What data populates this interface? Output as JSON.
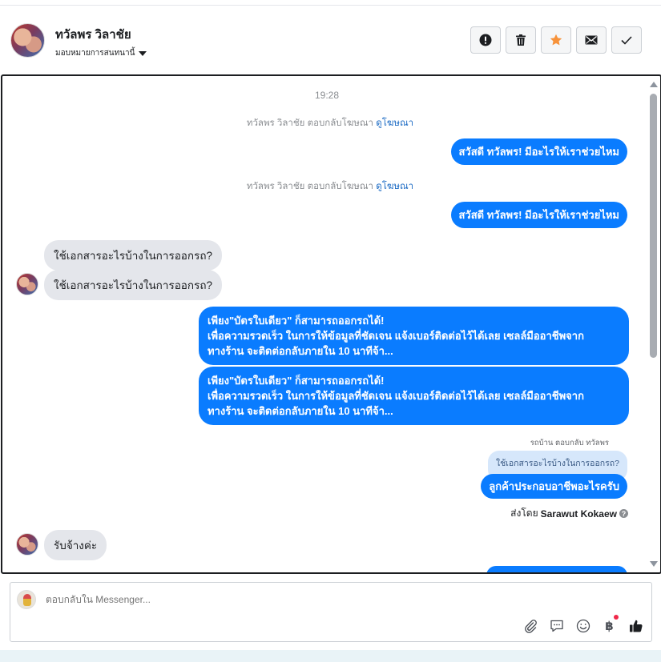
{
  "header": {
    "name": "ทวัลพร วิลาชัย",
    "assign_label": "มอบหมายการสนทนานี้",
    "actions": [
      {
        "icon": "alert-icon",
        "name": "mark-spam-button"
      },
      {
        "icon": "trash-icon",
        "name": "delete-button"
      },
      {
        "icon": "star-icon",
        "name": "star-button",
        "color": "#f7923a"
      },
      {
        "icon": "envelope-icon",
        "name": "mark-unread-button"
      },
      {
        "icon": "check-icon",
        "name": "mark-done-button"
      }
    ]
  },
  "conversation": {
    "timestamp": "19:28",
    "system_lines": [
      {
        "text": "ทวัลพร วิลาชัย ตอบกลับโฆษณา",
        "link": "ดูโฆษณา"
      },
      {
        "text": "ทวัลพร วิลาชัย ตอบกลับโฆษณา",
        "link": "ดูโฆษณา"
      }
    ],
    "outgoing_greeting": "สวัสดี ทวัลพร! มีอะไรให้เราช่วยไหม",
    "incoming_question": "ใช้เอกสารอะไรบ้างในการออกรถ?",
    "long_reply_line1": "เพียง\"บัตรใบเดียว\" ก็สามารถออกรถได้!",
    "long_reply_line2": "เพื่อความรวดเร็ว ในการให้ข้อมูลที่ชัดเจน แจ้งเบอร์ติดต่อไว้ได้เลย เซลล์มืออาชีพจาก",
    "long_reply_line3": "ทางร้าน จะติดต่อกลับภายใน 10 นาทีจ้า...",
    "reply_meta": "รถบ้าน ตอบกลับ ทวัลพร",
    "reply_quote": "ใช้เอกสารอะไรบ้างในการออกรถ?",
    "reply_text": "ลูกค้าประกอบอาชีพอะไรครับ",
    "sent_by_label": "ส่งโดย",
    "sent_by_name": "Sarawut Kokaew",
    "incoming_last": "รับจ้างค่ะ"
  },
  "composer": {
    "placeholder": "ตอบกลับใน Messenger...",
    "tools": [
      "paperclip-icon",
      "speech-bubble-icon",
      "smiley-icon",
      "baht-icon",
      "thumbs-up-icon"
    ],
    "baht_symbol": "฿",
    "accent": "#0a7cff"
  }
}
